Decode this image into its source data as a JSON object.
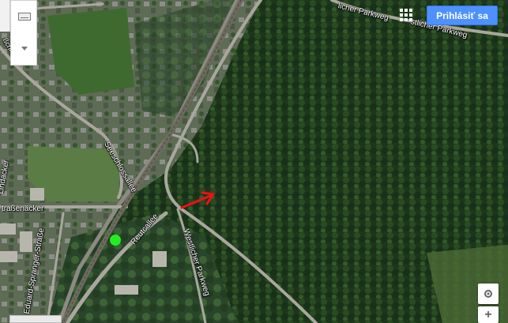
{
  "header": {
    "signin_label": "Prihlásiť sa"
  },
  "streets": {
    "seeschlossallee": "Seeschlossallee",
    "reutcallee": "Reutcallee",
    "westlicher_parkweg_vertical": "Westlicher Parkweg",
    "westlicher_parkweg_top": "licher Parkweg",
    "parkweg_top_right": "stlicher Parkweg",
    "strassenacker": "traßenäcker",
    "edward_spranger": "Eduard-Spranger-Straße",
    "left_vertical": "Lindacker"
  },
  "colors": {
    "forest": "#1f3a1c",
    "signin": "#4d90fe",
    "marker_green": "#22ee22",
    "arrow_red": "#ee1111"
  },
  "controls": {
    "apps_icon": "apps-grid-icon",
    "locate_icon": "my-location-icon",
    "zoom_in_label": "+",
    "zoom_in_icon": "zoom-in-icon"
  }
}
